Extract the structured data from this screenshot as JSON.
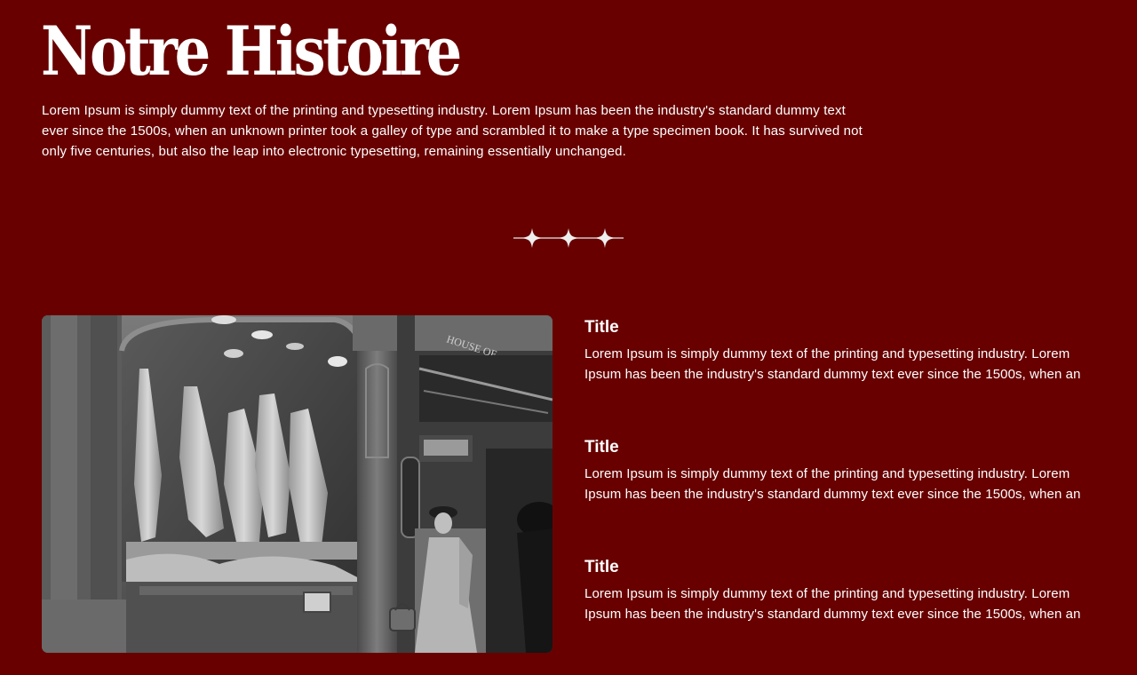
{
  "hero": {
    "title": "Notre Histoire",
    "intro": "Lorem Ipsum is simply dummy text of the printing and typesetting industry. Lorem Ipsum has been the industry's standard dummy text ever since the 1500s, when an unknown printer took a galley of type and scrambled it to make a type specimen book. It has survived not only five centuries, but also the leap into electronic typesetting, remaining essentially unchanged."
  },
  "divider": {
    "icon": "sparkle-divider-icon"
  },
  "photo": {
    "description_icon": "butcher-shop-photo",
    "sign_text": "HOUSE OF"
  },
  "features": [
    {
      "title": "Title",
      "text": "Lorem Ipsum is simply dummy text of the printing and typesetting industry. Lorem Ipsum has been the industry's standard dummy text ever since the 1500s, when an"
    },
    {
      "title": "Title",
      "text": "Lorem Ipsum is simply dummy text of the printing and typesetting industry. Lorem Ipsum has been the industry's standard dummy text ever since the 1500s, when an"
    },
    {
      "title": "Title",
      "text": "Lorem Ipsum is simply dummy text of the printing and typesetting industry. Lorem Ipsum has been the industry's standard dummy text ever since the 1500s, when an"
    }
  ],
  "colors": {
    "background": "#680000",
    "text": "#ffffff"
  }
}
